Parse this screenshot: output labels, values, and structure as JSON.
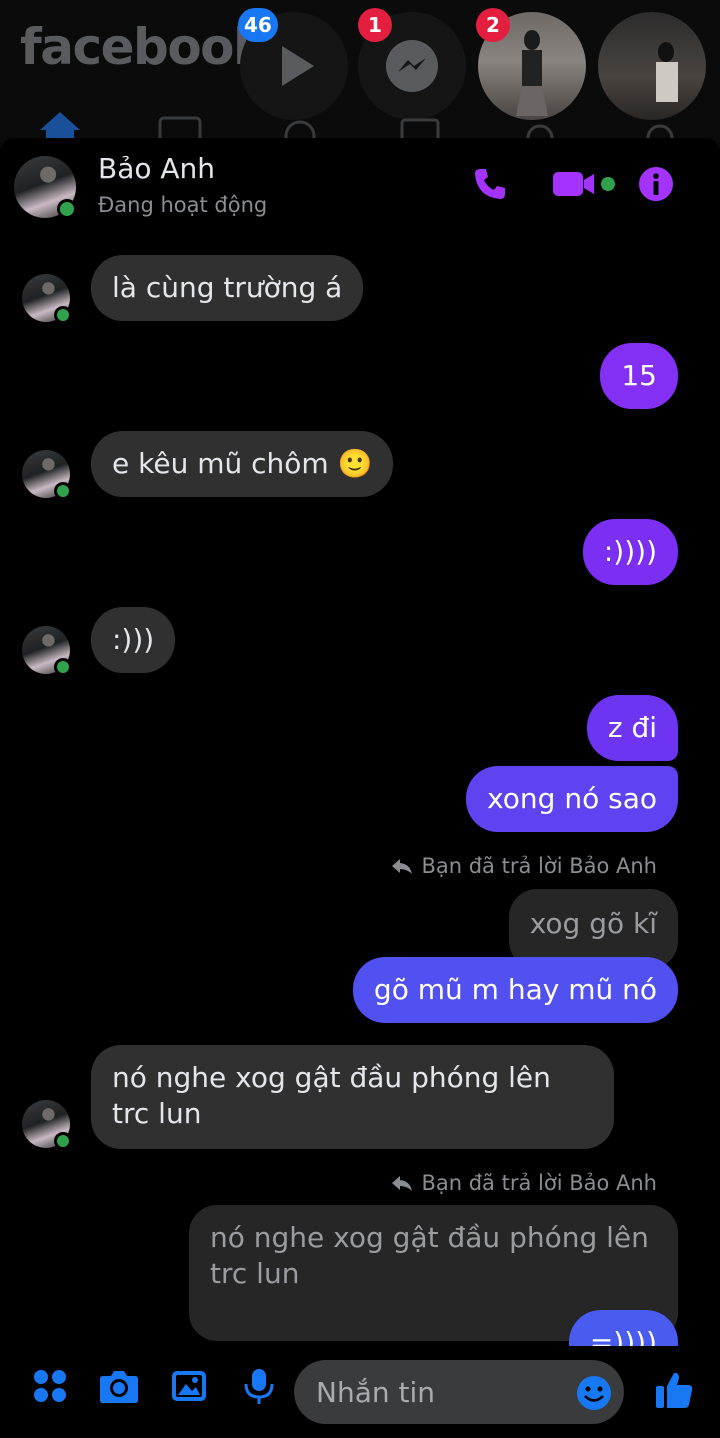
{
  "background_app": {
    "logo": "facebook",
    "badges": {
      "watch": "46",
      "messenger": "1",
      "story": "2"
    }
  },
  "header": {
    "contact_name": "Bảo Anh",
    "status": "Đang hoạt động"
  },
  "messages": [
    {
      "dir": "in",
      "text": "là cùng trường á"
    },
    {
      "dir": "out",
      "text": "15"
    },
    {
      "dir": "in",
      "text": "e kêu mũ chôm 🙂"
    },
    {
      "dir": "out",
      "text": ":))))"
    },
    {
      "dir": "in",
      "text": ":)))"
    },
    {
      "dir": "out",
      "text": "z đi"
    },
    {
      "dir": "out",
      "text": "xong nó sao"
    },
    {
      "dir": "note",
      "text": "Bạn đã trả lời Bảo Anh"
    },
    {
      "dir": "quote",
      "text": "xog gõ kĩ"
    },
    {
      "dir": "out",
      "text": "gõ mũ m hay mũ nó"
    },
    {
      "dir": "in",
      "text": "nó nghe xog gật đầu phóng lên trc lun"
    },
    {
      "dir": "note",
      "text": "Bạn đã trả lời Bảo Anh"
    },
    {
      "dir": "quote",
      "text": "nó nghe xog gật đầu phóng lên trc lun"
    },
    {
      "dir": "out",
      "text": "=))))"
    }
  ],
  "composer": {
    "placeholder": "Nhắn tin"
  },
  "colors": {
    "accent_purple": "#a533ff",
    "bubble_purple": "#7b2ff2",
    "bubble_blue": "#4f55f0",
    "incoming": "#303030",
    "icon_blue": "#1877f2",
    "online": "#31a24c"
  }
}
